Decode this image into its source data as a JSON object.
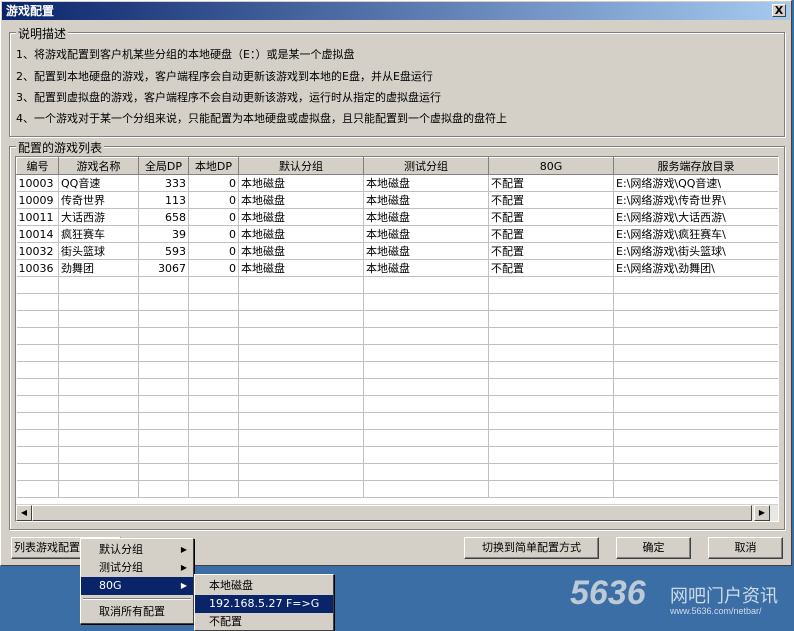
{
  "window": {
    "title": "游戏配置",
    "close_label": "X"
  },
  "description": {
    "title": "说明描述",
    "lines": [
      "1、将游戏配置到客户机某些分组的本地硬盘（E：）或是某一个虚拟盘",
      "2、配置到本地硬盘的游戏，客户端程序会自动更新该游戏到本地的E盘，并从E盘运行",
      "3、配置到虚拟盘的游戏，客户端程序不会自动更新该游戏，运行时从指定的虚拟盘运行",
      "4、一个游戏对于某一个分组来说，只能配置为本地硬盘或虚拟盘，且只能配置到一个虚拟盘的盘符上"
    ]
  },
  "list": {
    "title": "配置的游戏列表",
    "columns": [
      "编号",
      "游戏名称",
      "全局DP",
      "本地DP",
      "默认分组",
      "测试分组",
      "80G",
      "服务端存放目录"
    ],
    "rows": [
      [
        "10003",
        "QQ音速",
        "333",
        "0",
        "本地磁盘",
        "本地磁盘",
        "不配置",
        "E:\\网络游戏\\QQ音速\\"
      ],
      [
        "10009",
        "传奇世界",
        "113",
        "0",
        "本地磁盘",
        "本地磁盘",
        "不配置",
        "E:\\网络游戏\\传奇世界\\"
      ],
      [
        "10011",
        "大话西游",
        "658",
        "0",
        "本地磁盘",
        "本地磁盘",
        "不配置",
        "E:\\网络游戏\\大话西游\\"
      ],
      [
        "10014",
        "疯狂赛车",
        "39",
        "0",
        "本地磁盘",
        "本地磁盘",
        "不配置",
        "E:\\网络游戏\\疯狂赛车\\"
      ],
      [
        "10032",
        "街头篮球",
        "593",
        "0",
        "本地磁盘",
        "本地磁盘",
        "不配置",
        "E:\\网络游戏\\街头篮球\\"
      ],
      [
        "10036",
        "劲舞团",
        "3067",
        "0",
        "本地磁盘",
        "本地磁盘",
        "不配置",
        "E:\\网络游戏\\劲舞团\\"
      ]
    ]
  },
  "buttons": {
    "list_config": "列表游戏配置",
    "switch_simple": "切换到简单配置方式",
    "ok": "确定",
    "cancel": "取消"
  },
  "context_menu": {
    "items": [
      "默认分组",
      "测试分组",
      "80G",
      "取消所有配置"
    ]
  },
  "submenu": {
    "items": [
      "本地磁盘",
      "192.168.5.27 F=>G",
      "不配置"
    ]
  },
  "watermark": {
    "logo": "5636",
    "text": "网吧门户资讯",
    "url": "www.5636.com/netbar/"
  }
}
